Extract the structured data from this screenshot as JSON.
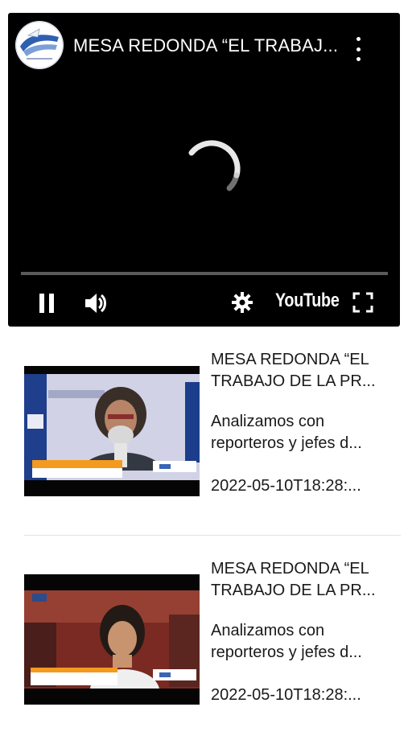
{
  "player": {
    "title": "MESA REDONDA “EL TRABAJ...",
    "youtube_label": "YouTube",
    "progress_fraction": 0
  },
  "videos": [
    {
      "title_line1": "MESA REDONDA “EL",
      "title_line2": "TRABAJO DE LA PR...",
      "desc_line1": "Analizamos con",
      "desc_line2": "reporteros y jefes d...",
      "date": "2022-05-10T18:28:..."
    },
    {
      "title_line1": "MESA REDONDA “EL",
      "title_line2": "TRABAJO DE LA PR...",
      "desc_line1": "Analizamos con",
      "desc_line2": "reporteros y jefes d...",
      "date": "2022-05-10T18:28:..."
    }
  ],
  "icons": [
    "channel-logo",
    "more-vert-icon",
    "loading-spinner",
    "pause-icon",
    "volume-icon",
    "settings-gear-icon",
    "fullscreen-icon"
  ]
}
